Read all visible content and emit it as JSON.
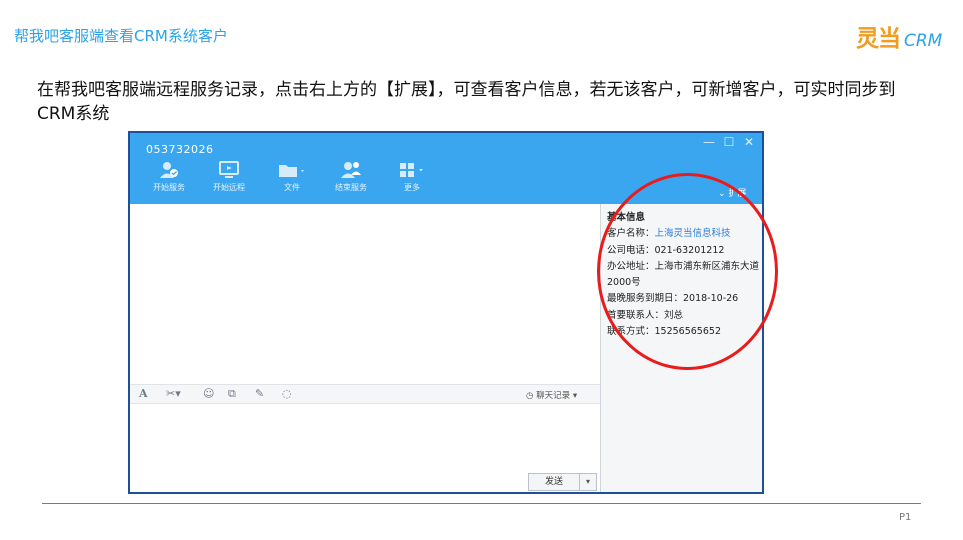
{
  "slide": {
    "title": "帮我吧客服端查看CRM系统客户",
    "logo_mark": "灵当",
    "logo_text": "CRM",
    "description": "在帮我吧客服端远程服务记录，点击右上方的【扩展】，可查看客户信息，若无该客户，可新增客户，可实时同步到CRM系统",
    "page_number": "P1"
  },
  "app": {
    "account_id": "053732026",
    "window_controls": [
      "minimize-icon",
      "maximize-icon",
      "close-icon"
    ],
    "toolbar": [
      {
        "label": "开始服务",
        "icon": "user-check-icon"
      },
      {
        "label": "开始远程",
        "icon": "monitor-icon"
      },
      {
        "label": "文件",
        "icon": "folder-icon"
      },
      {
        "label": "结束服务",
        "icon": "users-icon"
      },
      {
        "label": "更多",
        "icon": "grid-icon"
      }
    ],
    "expand_label": "扩展",
    "customer_info": {
      "heading": "基本信息",
      "name_label": "客户名称：",
      "name_value": "上海灵当信息科技",
      "phone": "公司电话：021-63201212",
      "address": "办公地址：上海市浦东新区浦东大道2000号",
      "service_expiry": "最晚服务到期日：2018-10-26",
      "primary_contact": "首要联系人：刘总",
      "contact_method": "联系方式：15256565652"
    },
    "input_toolbar_icons": [
      "font-icon",
      "scissors-icon",
      "emoji-icon",
      "screenshot-icon",
      "edit-icon",
      "shake-icon"
    ],
    "chat_history_label": "聊天记录",
    "send_label": "发送"
  },
  "colors": {
    "header_blue": "#3aa6ef",
    "title_blue": "#2aa3e6",
    "logo_orange": "#f29b1e",
    "highlight_red": "#e81c1c"
  }
}
